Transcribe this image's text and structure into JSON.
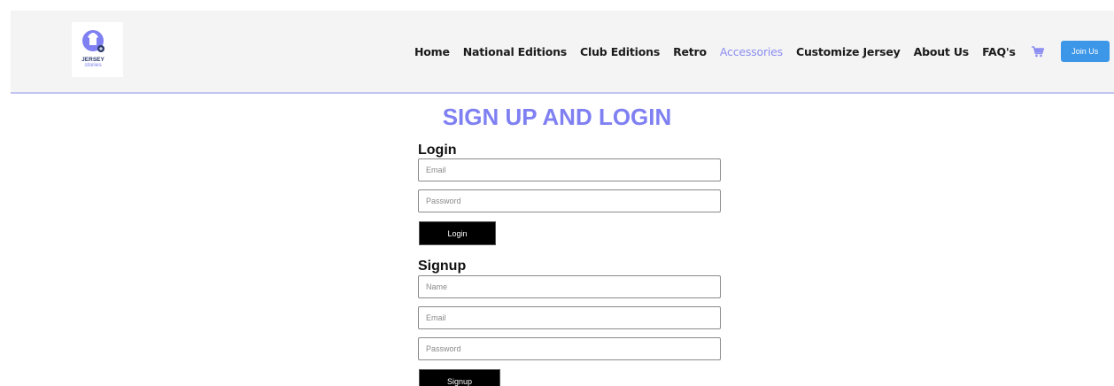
{
  "header": {
    "logo": {
      "alt_text": "JERSEY stories"
    },
    "nav": [
      {
        "label": "Home"
      },
      {
        "label": "National Editions"
      },
      {
        "label": "Club Editions"
      },
      {
        "label": "Retro"
      },
      {
        "label": "Accessories",
        "active": true
      },
      {
        "label": "Customize Jersey"
      },
      {
        "label": "About Us"
      },
      {
        "label": "FAQ's"
      }
    ],
    "cart_icon": "cart-icon",
    "join_label": "Join Us"
  },
  "main": {
    "title": "SIGN UP AND LOGIN",
    "login": {
      "heading": "Login",
      "email_placeholder": "Email",
      "password_placeholder": "Password",
      "button_label": "Login"
    },
    "signup": {
      "heading": "Signup",
      "name_placeholder": "Name",
      "email_placeholder": "Email",
      "password_placeholder": "Password",
      "button_label": "Signup"
    }
  },
  "colors": {
    "accent": "#7f80f2",
    "nav_active": "#8b8df2",
    "join_button": "#3d97e8",
    "header_bg": "#f4f4f4"
  }
}
